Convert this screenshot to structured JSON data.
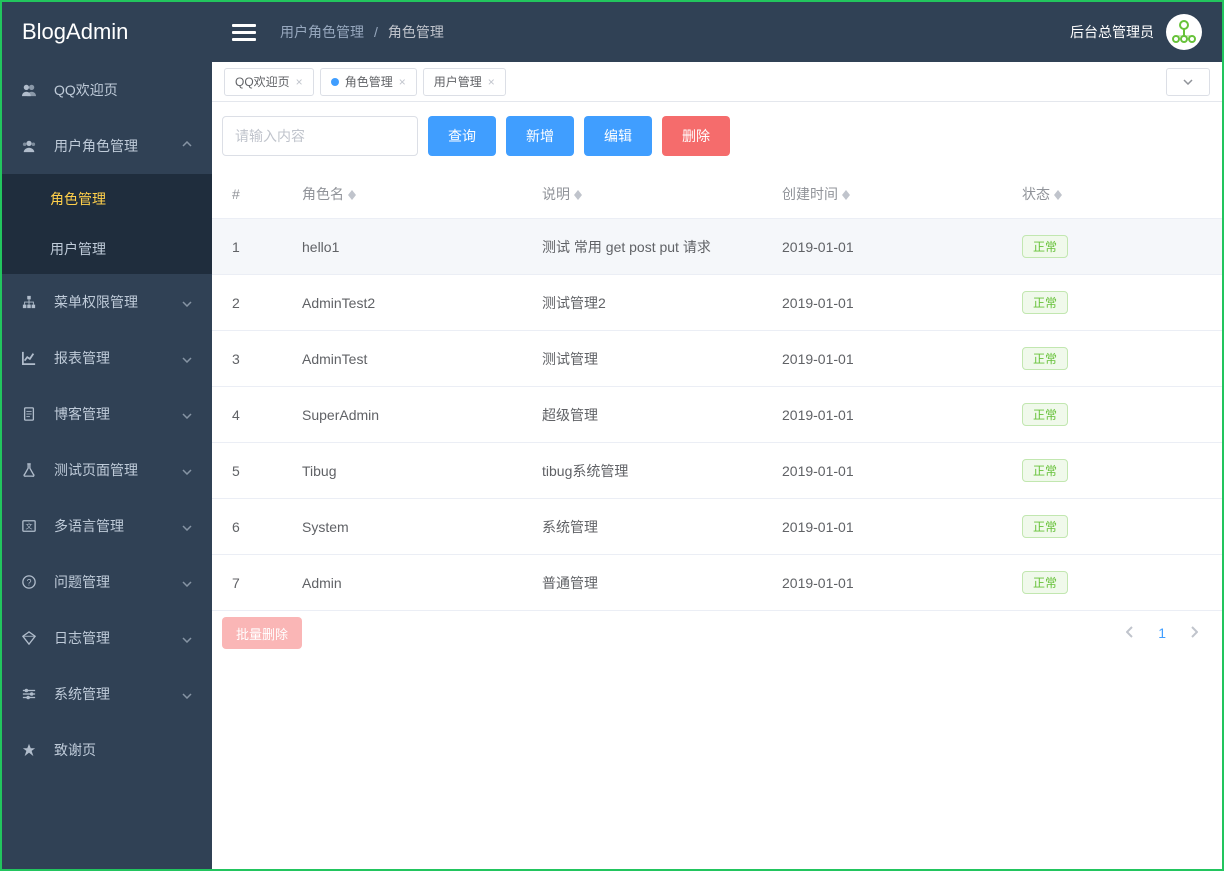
{
  "brand": "BlogAdmin",
  "topbar": {
    "breadcrumbParent": "用户角色管理",
    "breadcrumbCurrent": "角色管理",
    "adminLabel": "后台总管理员"
  },
  "sidebar": {
    "items": [
      {
        "icon": "friends",
        "label": "QQ欢迎页",
        "hasChildren": false
      },
      {
        "icon": "users",
        "label": "用户角色管理",
        "hasChildren": true,
        "expanded": true,
        "children": [
          {
            "label": "角色管理",
            "active": true
          },
          {
            "label": "用户管理",
            "active": false
          }
        ]
      },
      {
        "icon": "sitemap",
        "label": "菜单权限管理",
        "hasChildren": true
      },
      {
        "icon": "chart",
        "label": "报表管理",
        "hasChildren": true
      },
      {
        "icon": "doc",
        "label": "博客管理",
        "hasChildren": true
      },
      {
        "icon": "flask",
        "label": "测试页面管理",
        "hasChildren": true
      },
      {
        "icon": "lang",
        "label": "多语言管理",
        "hasChildren": true
      },
      {
        "icon": "question",
        "label": "问题管理",
        "hasChildren": true
      },
      {
        "icon": "diamond",
        "label": "日志管理",
        "hasChildren": true
      },
      {
        "icon": "sliders",
        "label": "系统管理",
        "hasChildren": true
      },
      {
        "icon": "star",
        "label": "致谢页",
        "hasChildren": false
      }
    ]
  },
  "tabs": [
    {
      "label": "QQ欢迎页",
      "active": false
    },
    {
      "label": "角色管理",
      "active": true
    },
    {
      "label": "用户管理",
      "active": false
    }
  ],
  "toolbar": {
    "searchPlaceholder": "请输入内容",
    "btnQuery": "查询",
    "btnAdd": "新增",
    "btnEdit": "编辑",
    "btnDelete": "删除"
  },
  "table": {
    "headers": {
      "idx": "#",
      "name": "角色名",
      "desc": "说明",
      "time": "创建时间",
      "status": "状态"
    },
    "rows": [
      {
        "idx": "1",
        "name": "hello1",
        "desc": "测试 常用 get post put 请求",
        "time": "2019-01-01",
        "status": "正常",
        "selected": true
      },
      {
        "idx": "2",
        "name": "AdminTest2",
        "desc": "测试管理2",
        "time": "2019-01-01",
        "status": "正常"
      },
      {
        "idx": "3",
        "name": "AdminTest",
        "desc": "测试管理",
        "time": "2019-01-01",
        "status": "正常"
      },
      {
        "idx": "4",
        "name": "SuperAdmin",
        "desc": "超级管理",
        "time": "2019-01-01",
        "status": "正常"
      },
      {
        "idx": "5",
        "name": "Tibug",
        "desc": "tibug系统管理",
        "time": "2019-01-01",
        "status": "正常"
      },
      {
        "idx": "6",
        "name": "System",
        "desc": "系统管理",
        "time": "2019-01-01",
        "status": "正常"
      },
      {
        "idx": "7",
        "name": "Admin",
        "desc": "普通管理",
        "time": "2019-01-01",
        "status": "正常"
      }
    ],
    "batchDelete": "批量删除",
    "page": "1"
  }
}
